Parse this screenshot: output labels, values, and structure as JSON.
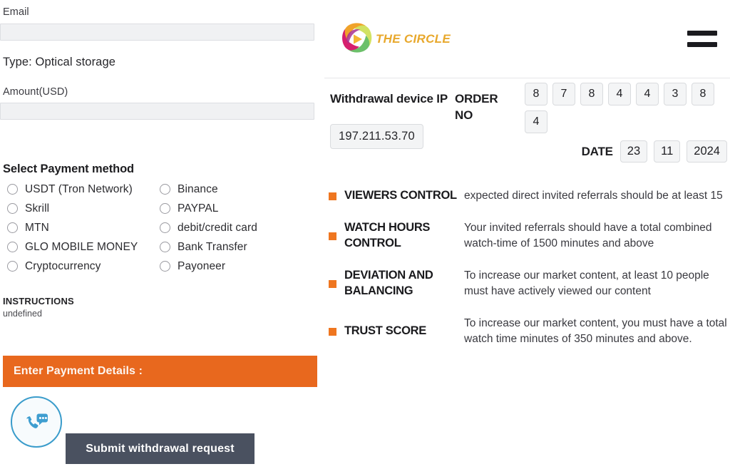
{
  "form": {
    "email_label": "Email",
    "email_value": "",
    "email_placeholder": "",
    "type_line": "Type: Optical storage",
    "amount_label": "Amount(USD)",
    "amount_value": "",
    "amount_placeholder": "",
    "payment_section_title": "Select Payment method",
    "payment_methods_left": [
      "USDT (Tron Network)",
      "Skrill",
      "MTN",
      "GLO MOBILE MONEY",
      "Cryptocurrency"
    ],
    "payment_methods_right": [
      "Binance",
      "PAYPAL",
      "debit/credit card",
      "Bank Transfer",
      "Payoneer"
    ],
    "instructions_title": "INSTRUCTIONS",
    "instructions_body": "undefined",
    "enter_payment_details": "Enter Payment Details :",
    "submit_label": "Submit withdrawal request"
  },
  "header": {
    "brand_name": "THE CIRCLE",
    "menu_icon": "hamburger-icon",
    "brand_color": "#e8a82c"
  },
  "order": {
    "withdrawal_device_ip_label": "Withdrawal device IP",
    "order_no_label": "ORDER NO",
    "ip_value": "197.211.53.70",
    "order_digits": [
      "8",
      "7",
      "8",
      "4",
      "4",
      "3",
      "8",
      "4"
    ],
    "date_caption": "DATE",
    "date_day": "23",
    "date_month": "11",
    "date_year": "2024"
  },
  "rules": {
    "bullet_color": "#ef7620",
    "items": [
      {
        "term": "VIEWERS CONTROL",
        "description": "expected direct invited referrals should be at least 15"
      },
      {
        "term": "WATCH HOURS CONTROL",
        "description": "Your invited referrals should have a total combined watch-time of 1500 minutes and above"
      },
      {
        "term": "DEVIATION AND BALANCING",
        "description": "To increase our market content, at least 10 people must have actively viewed our content"
      },
      {
        "term": "TRUST SCORE",
        "description": "To increase our market content, you must have a total watch time minutes of 350 minutes and above."
      }
    ]
  },
  "chat_widget": {
    "icon": "phone-chat-icon",
    "color": "#3a9ccb"
  },
  "theme": {
    "orange": "#e8681e",
    "submit_gray": "#4a5160"
  }
}
